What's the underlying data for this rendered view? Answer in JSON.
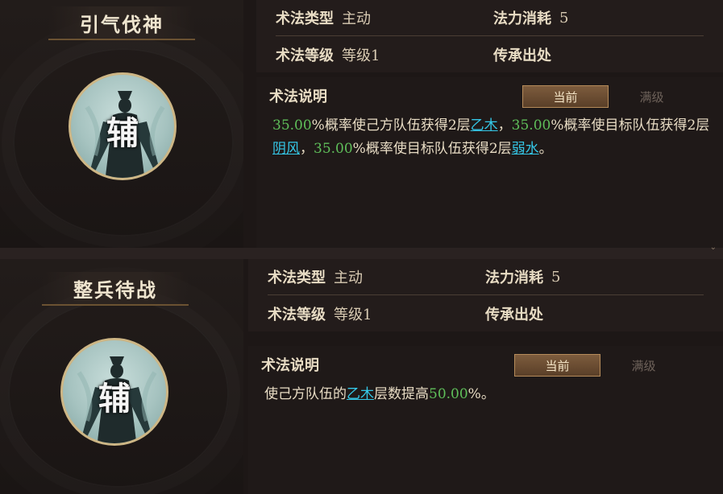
{
  "labels": {
    "type": "术法类型",
    "cost": "法力消耗",
    "level": "术法等级",
    "source": "传承出处",
    "desc": "术法说明",
    "tab_current": "当前",
    "tab_max": "满级"
  },
  "skills": [
    {
      "name": "引气伐神",
      "role": "辅",
      "type": "主动",
      "cost": "5",
      "level": "等级1",
      "source": "",
      "desc": {
        "p1": "35.00",
        "t1": "%概率使己方队伍获得2层",
        "k1": "乙木",
        "t2": "，",
        "p2": "35.00",
        "t3": "%概率使目标队伍获得2层",
        "k2": "阴风",
        "t4": "，",
        "p3": "35.00",
        "t5": "%概率使目标队伍获得2层",
        "k3": "弱水",
        "t6": "。"
      }
    },
    {
      "name": "整兵待战",
      "role": "辅",
      "type": "主动",
      "cost": "5",
      "level": "等级1",
      "source": "",
      "desc": {
        "t1": "使己方队伍的",
        "k1": "乙木",
        "t2": "层数提高",
        "p1": "50.00",
        "t3": "%。"
      }
    }
  ],
  "colors": {
    "percent": "#5fbf5a",
    "keyword": "#35c8e8",
    "tab_active": "#7d5c3d"
  }
}
